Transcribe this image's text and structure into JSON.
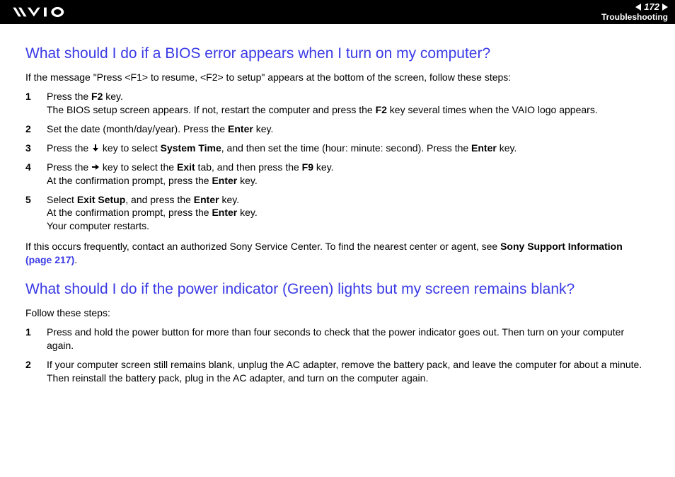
{
  "header": {
    "page_number": "172",
    "section": "Troubleshooting"
  },
  "sections": [
    {
      "heading": "What should I do if a BIOS error appears when I turn on my computer?",
      "intro": "If the message \"Press <F1> to resume, <F2> to setup\" appears at the bottom of the screen, follow these steps:",
      "steps": [
        {
          "n": "1",
          "parts": [
            {
              "t": "Press the "
            },
            {
              "t": "F2",
              "b": true
            },
            {
              "t": " key."
            },
            {
              "br": true
            },
            {
              "t": "The BIOS setup screen appears. If not, restart the computer and press the "
            },
            {
              "t": "F2",
              "b": true
            },
            {
              "t": " key several times when the VAIO logo appears."
            }
          ]
        },
        {
          "n": "2",
          "parts": [
            {
              "t": "Set the date (month/day/year). Press the "
            },
            {
              "t": "Enter",
              "b": true
            },
            {
              "t": " key."
            }
          ]
        },
        {
          "n": "3",
          "parts": [
            {
              "t": "Press the "
            },
            {
              "icon": "arrow-down"
            },
            {
              "t": " key to select "
            },
            {
              "t": "System Time",
              "b": true
            },
            {
              "t": ", and then set the time (hour: minute: second). Press the "
            },
            {
              "t": "Enter",
              "b": true
            },
            {
              "t": " key."
            }
          ]
        },
        {
          "n": "4",
          "parts": [
            {
              "t": "Press the "
            },
            {
              "icon": "arrow-right"
            },
            {
              "t": " key to select the "
            },
            {
              "t": "Exit",
              "b": true
            },
            {
              "t": " tab, and then press the "
            },
            {
              "t": "F9",
              "b": true
            },
            {
              "t": " key."
            },
            {
              "br": true
            },
            {
              "t": "At the confirmation prompt, press the "
            },
            {
              "t": "Enter",
              "b": true
            },
            {
              "t": " key."
            }
          ]
        },
        {
          "n": "5",
          "parts": [
            {
              "t": "Select "
            },
            {
              "t": "Exit Setup",
              "b": true
            },
            {
              "t": ", and press the "
            },
            {
              "t": "Enter",
              "b": true
            },
            {
              "t": " key."
            },
            {
              "br": true
            },
            {
              "t": "At the confirmation prompt, press the "
            },
            {
              "t": "Enter",
              "b": true
            },
            {
              "t": " key."
            },
            {
              "br": true
            },
            {
              "t": "Your computer restarts."
            }
          ]
        }
      ],
      "outro_parts": [
        {
          "t": "If this occurs frequently, contact an authorized Sony Service Center. To find the nearest center or agent, see "
        },
        {
          "t": "Sony Support Information",
          "b": true
        },
        {
          "t": " "
        },
        {
          "t": "(page 217)",
          "link": true
        },
        {
          "t": "."
        }
      ]
    },
    {
      "heading": "What should I do if the power indicator (Green) lights but my screen remains blank?",
      "intro": "Follow these steps:",
      "steps": [
        {
          "n": "1",
          "parts": [
            {
              "t": "Press and hold the power button for more than four seconds to check that the power indicator goes out. Then turn on your computer again."
            }
          ]
        },
        {
          "n": "2",
          "parts": [
            {
              "t": "If your computer screen still remains blank, unplug the AC adapter, remove the battery pack, and leave the computer for about a minute. Then reinstall the battery pack, plug in the AC adapter, and turn on the computer again."
            }
          ]
        }
      ]
    }
  ]
}
